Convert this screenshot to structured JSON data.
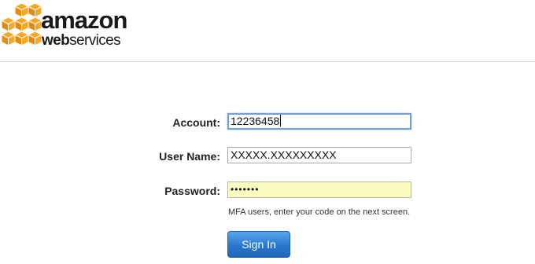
{
  "logo": {
    "word1": "amazon",
    "word2_bold": "web",
    "word2_rest": "services",
    "cube_color": "#f7a823"
  },
  "form": {
    "account": {
      "label": "Account:",
      "value": "12236458"
    },
    "username": {
      "label": "User Name:",
      "value": "XXXXX.XXXXXXXXX"
    },
    "password": {
      "label": "Password:",
      "value": "•••••••"
    },
    "hint": "MFA users, enter your code on the next screen.",
    "submit_label": "Sign In"
  }
}
